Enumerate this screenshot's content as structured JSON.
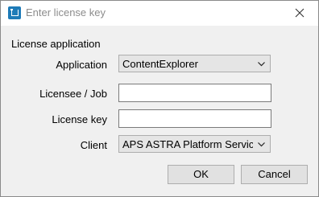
{
  "window": {
    "title": "Enter license key"
  },
  "form": {
    "group_label": "License application",
    "application": {
      "label": "Application",
      "value": "ContentExplorer"
    },
    "licensee": {
      "label": "Licensee / Job",
      "value": ""
    },
    "license_key": {
      "label": "License key",
      "value": ""
    },
    "client": {
      "label": "Client",
      "value": "APS ASTRA Platform Services"
    }
  },
  "buttons": {
    "ok": "OK",
    "cancel": "Cancel"
  },
  "icons": {
    "app": "license-app-icon",
    "close": "close-icon",
    "dropdown": "chevron-down-icon"
  },
  "colors": {
    "accent": "#1e7bb8",
    "dialog_bg": "#f0f0f0",
    "title_text": "#8c8c8c"
  }
}
